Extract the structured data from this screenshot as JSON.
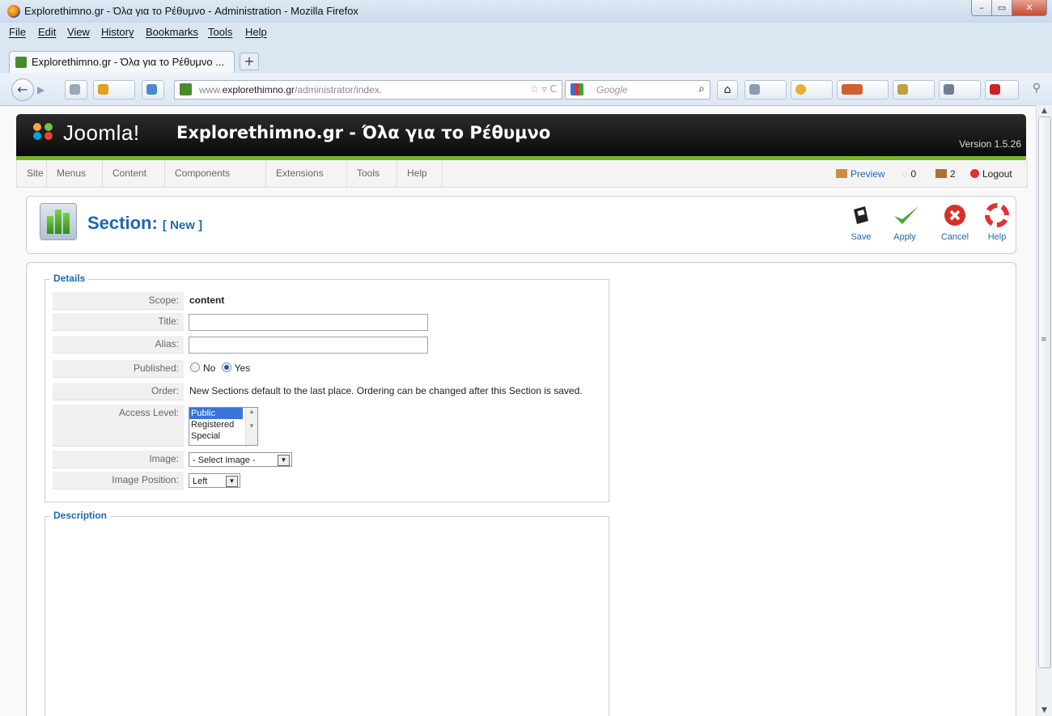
{
  "browser": {
    "window_title": "Explorethimno.gr - Όλα για το Ρέθυμνο - Administration - Mozilla Firefox",
    "menu": [
      "File",
      "Edit",
      "View",
      "History",
      "Bookmarks",
      "Tools",
      "Help"
    ],
    "tab_label": "Explorethimno.gr - Όλα για το Ρέθυμνο ...",
    "newtab": "+",
    "url_prefix": "www.",
    "url_domain": "explorethimno.gr",
    "url_path": "/administrator/index.",
    "search_placeholder": "Google",
    "icons": [
      "firefox-icon",
      "back-icon",
      "forward-icon",
      "home-icon",
      "search-icon",
      "bookmark-star-icon",
      "reload-icon",
      "zoom-icon"
    ]
  },
  "joomla": {
    "logo_text": "Joomla!",
    "site_name": "Explorethimno.gr - Όλα για το Ρέθυμνο",
    "version": "Version 1.5.26",
    "menu": [
      "Site",
      "Menus",
      "Content",
      "Components",
      "Extensions",
      "Tools",
      "Help"
    ],
    "status": {
      "preview": "Preview",
      "messages": "0",
      "users": "2",
      "logout": "Logout"
    }
  },
  "toolbar": {
    "title": "Section:",
    "title_suffix": "[ New ]",
    "buttons": {
      "save": "Save",
      "apply": "Apply",
      "cancel": "Cancel",
      "help": "Help"
    }
  },
  "details": {
    "legend": "Details",
    "scope_label": "Scope:",
    "scope_value": "content",
    "title_label": "Title:",
    "title_value": "",
    "alias_label": "Alias:",
    "alias_value": "",
    "published_label": "Published:",
    "published_no": "No",
    "published_yes": "Yes",
    "published_selected": "Yes",
    "order_label": "Order:",
    "order_value": "New Sections default to the last place. Ordering can be changed after this Section is saved.",
    "access_label": "Access Level:",
    "access_options": [
      "Public",
      "Registered",
      "Special"
    ],
    "access_selected": "Public",
    "image_label": "Image:",
    "image_value": "- Select Image -",
    "image_position_label": "Image Position:",
    "image_position_value": "Left"
  },
  "description": {
    "legend": "Description"
  }
}
